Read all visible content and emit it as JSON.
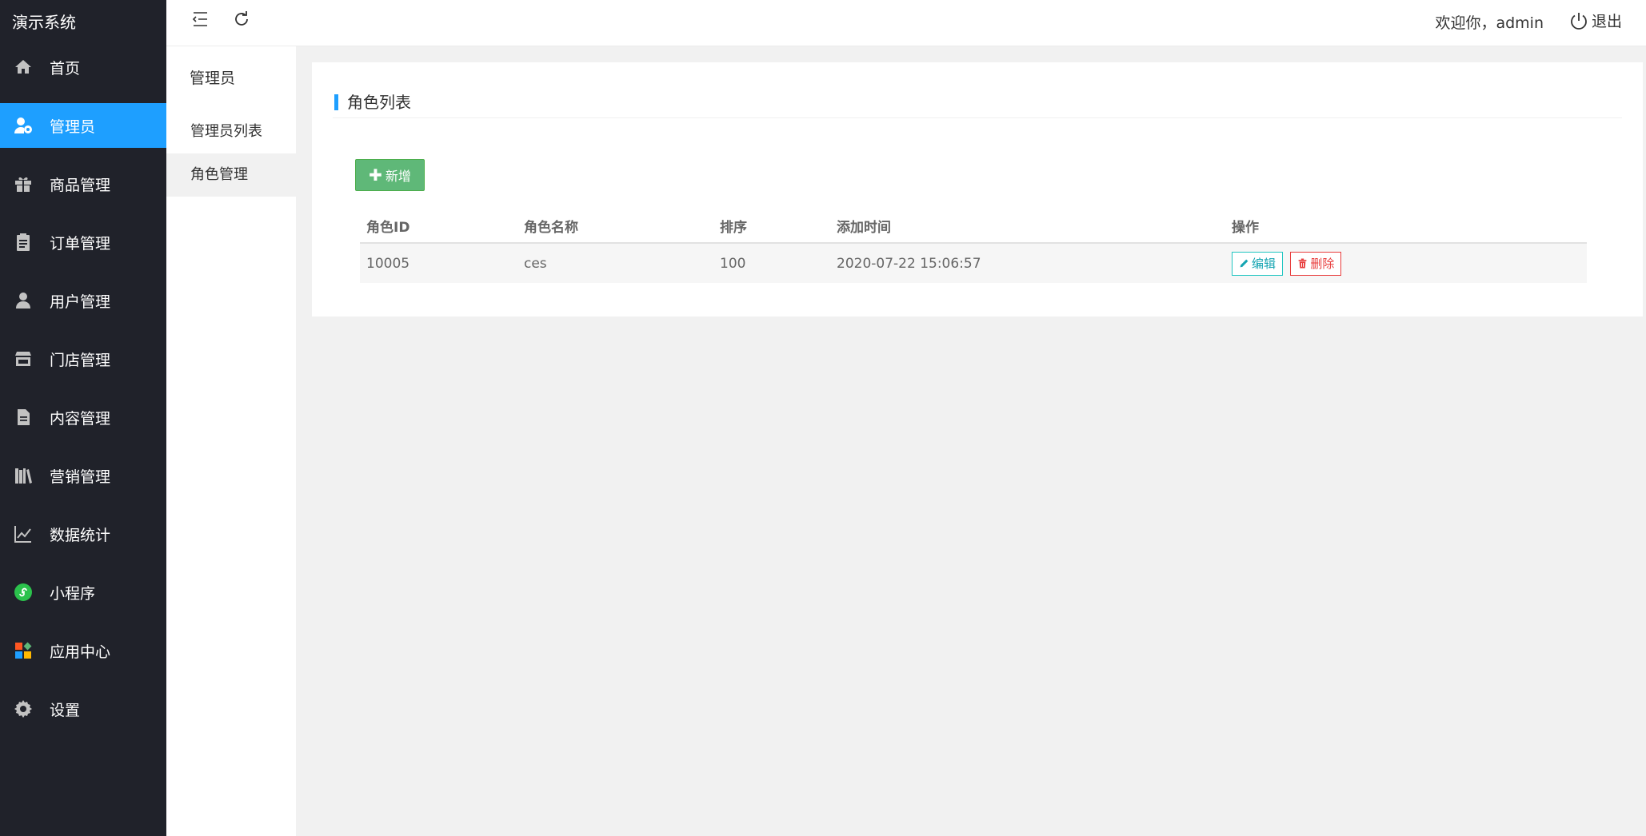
{
  "app": {
    "title": "演示系统"
  },
  "sidebar": {
    "items": [
      {
        "label": "首页",
        "icon": "home-icon"
      },
      {
        "label": "管理员",
        "icon": "admin-user-icon",
        "active": true
      },
      {
        "label": "商品管理",
        "icon": "gift-icon"
      },
      {
        "label": "订单管理",
        "icon": "clipboard-icon"
      },
      {
        "label": "用户管理",
        "icon": "user-icon"
      },
      {
        "label": "门店管理",
        "icon": "store-icon"
      },
      {
        "label": "内容管理",
        "icon": "document-icon"
      },
      {
        "label": "营销管理",
        "icon": "books-icon"
      },
      {
        "label": "数据统计",
        "icon": "line-chart-icon"
      },
      {
        "label": "小程序",
        "icon": "mini-program-icon"
      },
      {
        "label": "应用中心",
        "icon": "apps-icon"
      },
      {
        "label": "设置",
        "icon": "gear-icon"
      }
    ]
  },
  "subnav": {
    "title": "管理员",
    "items": [
      {
        "label": "管理员列表"
      },
      {
        "label": "角色管理",
        "active": true
      }
    ]
  },
  "header": {
    "welcome": "欢迎你，admin",
    "logout": "退出"
  },
  "main": {
    "card_title": "角色列表",
    "add_button": "新增",
    "table": {
      "headers": [
        "角色ID",
        "角色名称",
        "排序",
        "添加时间",
        "操作"
      ],
      "rows": [
        {
          "id": "10005",
          "name": "ces",
          "sort": "100",
          "time": "2020-07-22 15:06:57",
          "edit": "编辑",
          "delete": "删除"
        }
      ]
    }
  },
  "colors": {
    "sidebar_bg": "#20222a",
    "accent": "#1e9fff",
    "add_button": "#5fb878",
    "edit": "#16a5b2",
    "delete": "#e83c3c"
  }
}
